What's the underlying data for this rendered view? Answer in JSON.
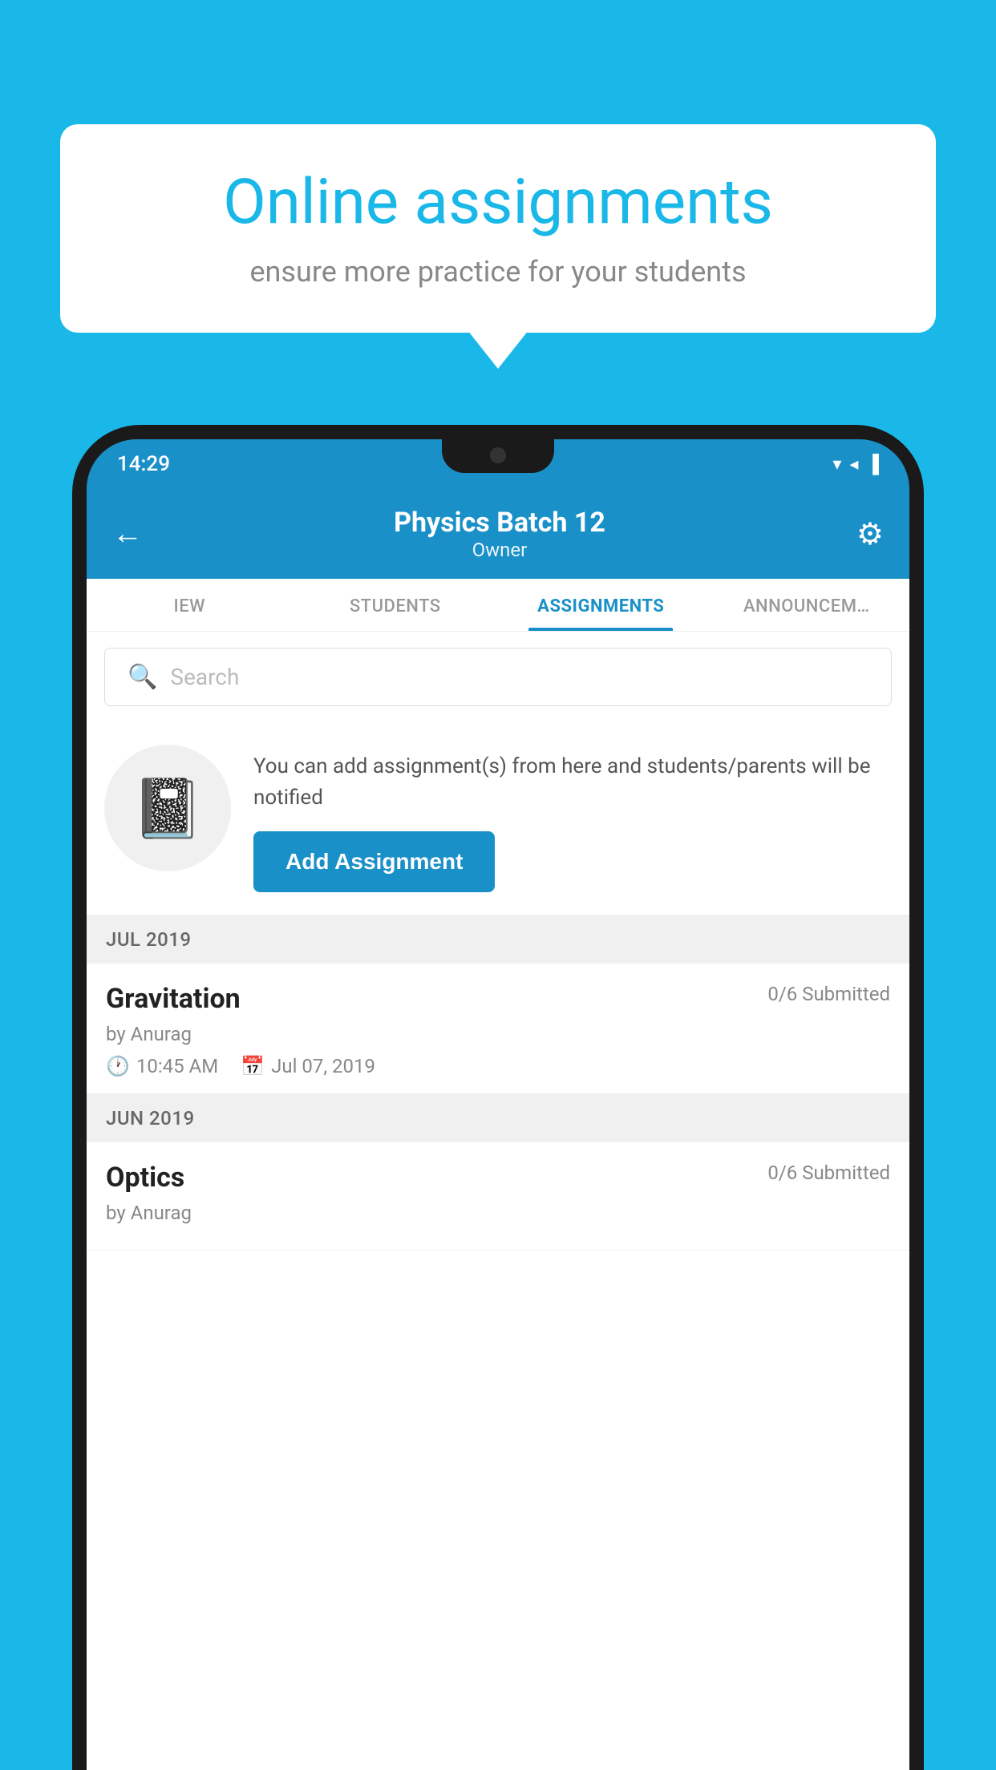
{
  "background": {
    "color": "#1ab8e8"
  },
  "speech_bubble": {
    "title": "Online assignments",
    "subtitle": "ensure more practice for your students"
  },
  "phone": {
    "status_bar": {
      "time": "14:29",
      "icons": "▼◀▐"
    },
    "header": {
      "title": "Physics Batch 12",
      "subtitle": "Owner",
      "back_label": "←",
      "gear_label": "⚙"
    },
    "tabs": [
      {
        "label": "IEW",
        "active": false
      },
      {
        "label": "STUDENTS",
        "active": false
      },
      {
        "label": "ASSIGNMENTS",
        "active": true
      },
      {
        "label": "ANNOUNCEM…",
        "active": false
      }
    ],
    "search": {
      "placeholder": "Search"
    },
    "promo": {
      "description": "You can add assignment(s) from here and students/parents will be notified",
      "button_label": "Add Assignment"
    },
    "sections": [
      {
        "label": "JUL 2019",
        "assignments": [
          {
            "title": "Gravitation",
            "submitted": "0/6 Submitted",
            "by": "by Anurag",
            "time": "10:45 AM",
            "date": "Jul 07, 2019"
          }
        ]
      },
      {
        "label": "JUN 2019",
        "assignments": [
          {
            "title": "Optics",
            "submitted": "0/6 Submitted",
            "by": "by Anurag",
            "time": "",
            "date": ""
          }
        ]
      }
    ]
  }
}
